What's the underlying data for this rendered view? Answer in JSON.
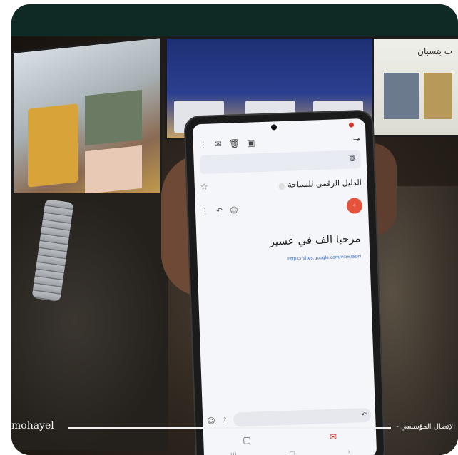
{
  "caption": {
    "left_name": "mohayel",
    "right_text": "- الإتصال المؤسسي"
  },
  "scene_label": "ت بتسبان",
  "phone": {
    "promo_text": "",
    "subject": "الدليل الرقمي للسياحة",
    "greeting": "مرحبا الف في عسير",
    "link": "https://sites.google.com/view/asir/",
    "icons": {
      "back": "back-arrow-icon",
      "archive": "archive-icon",
      "delete": "trash-icon",
      "mark_unread": "mail-icon",
      "more": "more-icon",
      "star": "star-icon",
      "reply": "reply-icon",
      "emoji": "emoji-icon"
    }
  }
}
